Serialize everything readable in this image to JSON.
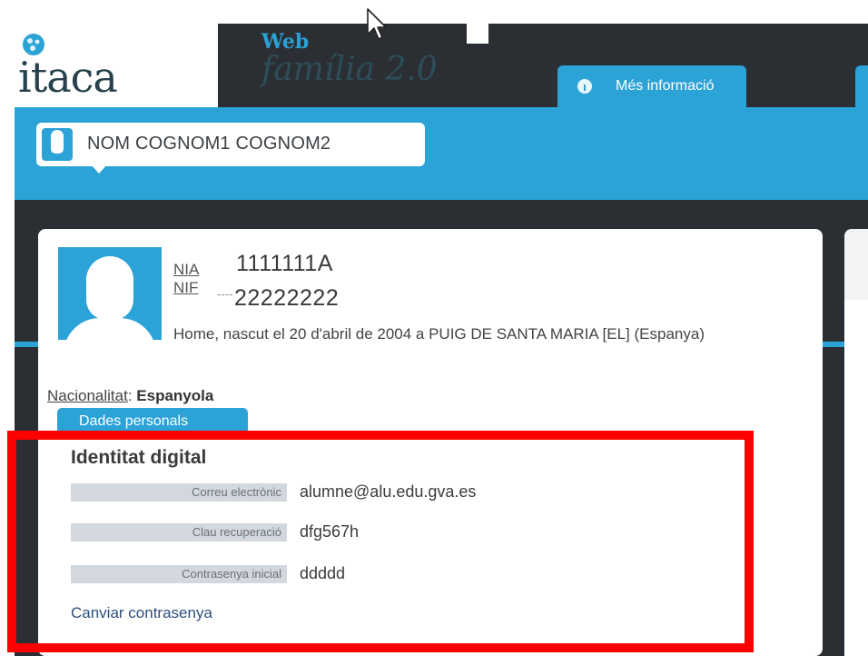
{
  "header": {
    "logo_text": "itaca",
    "web_label": "Web",
    "familia_label": "família 2.0",
    "tab_info_label": "Més informació"
  },
  "student": {
    "name": "NOM COGNOM1 COGNOM2",
    "nia_label": "NIA",
    "nif_label": "NIF",
    "nia_value": "1111111A",
    "nif_value": "22222222",
    "birth_info": "Home, nascut el 20 d'abril de 2004 a PUIG DE SANTA MARIA [EL] (Espanya)",
    "nacionalitat_label": "Nacionalitat",
    "nacionalitat_value": "Espanyola"
  },
  "tabs": {
    "dades_personals": "Dades personals"
  },
  "identitat": {
    "title": "Identitat digital",
    "fields": [
      {
        "label": "Correu electrònic",
        "value": "alumne@alu.edu.gva.es"
      },
      {
        "label": "Clau recuperació",
        "value": "dfg567h"
      },
      {
        "label": "Contrasenya inicial",
        "value": "ddddd"
      }
    ],
    "change_password_link": "Canviar contrasenya"
  },
  "colors": {
    "accent_blue": "#2ca3d6",
    "dark_background": "#2b2f33",
    "highlight_red": "#ff0000",
    "field_label_bg": "#d2d8dd"
  }
}
